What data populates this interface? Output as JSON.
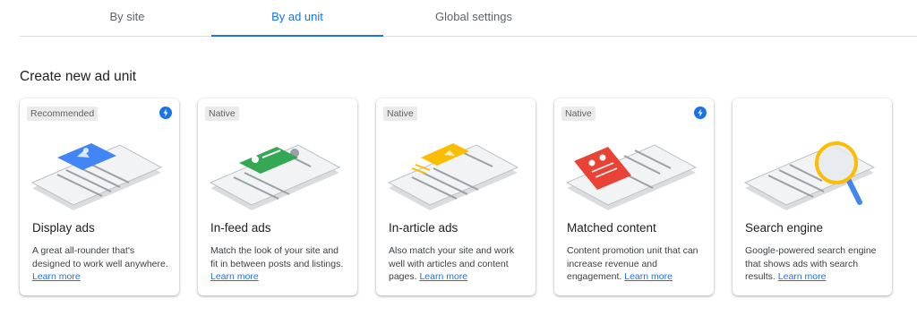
{
  "tabs": [
    {
      "label": "By site",
      "active": false
    },
    {
      "label": "By ad unit",
      "active": true
    },
    {
      "label": "Global settings",
      "active": false
    }
  ],
  "section_title": "Create new ad unit",
  "colors": {
    "accent": "#1a73e8",
    "display": "#4285f4",
    "infeed": "#34a853",
    "inarticle": "#fbbc04",
    "matched": "#ea4335",
    "search": "#fbbc04"
  },
  "cards": [
    {
      "badge": "Recommended",
      "has_bolt": true,
      "icon": "display-ads-illustration",
      "title": "Display ads",
      "description": "A great all-rounder that's designed to work well anywhere.",
      "link": "Learn more"
    },
    {
      "badge": "Native",
      "has_bolt": false,
      "icon": "in-feed-ads-illustration",
      "title": "In-feed ads",
      "description": "Match the look of your site and fit in between posts and listings.",
      "link": "Learn more"
    },
    {
      "badge": "Native",
      "has_bolt": false,
      "icon": "in-article-ads-illustration",
      "title": "In-article ads",
      "description": "Also match your site and work well with articles and content pages.",
      "link": "Learn more"
    },
    {
      "badge": "Native",
      "has_bolt": true,
      "icon": "matched-content-illustration",
      "title": "Matched content",
      "description": "Content promotion unit that can increase revenue and engagement.",
      "link": "Learn more"
    },
    {
      "badge": "",
      "has_bolt": false,
      "icon": "search-engine-illustration",
      "title": "Search engine",
      "description": "Google-powered search engine that shows ads with search results.",
      "link": "Learn more"
    }
  ]
}
